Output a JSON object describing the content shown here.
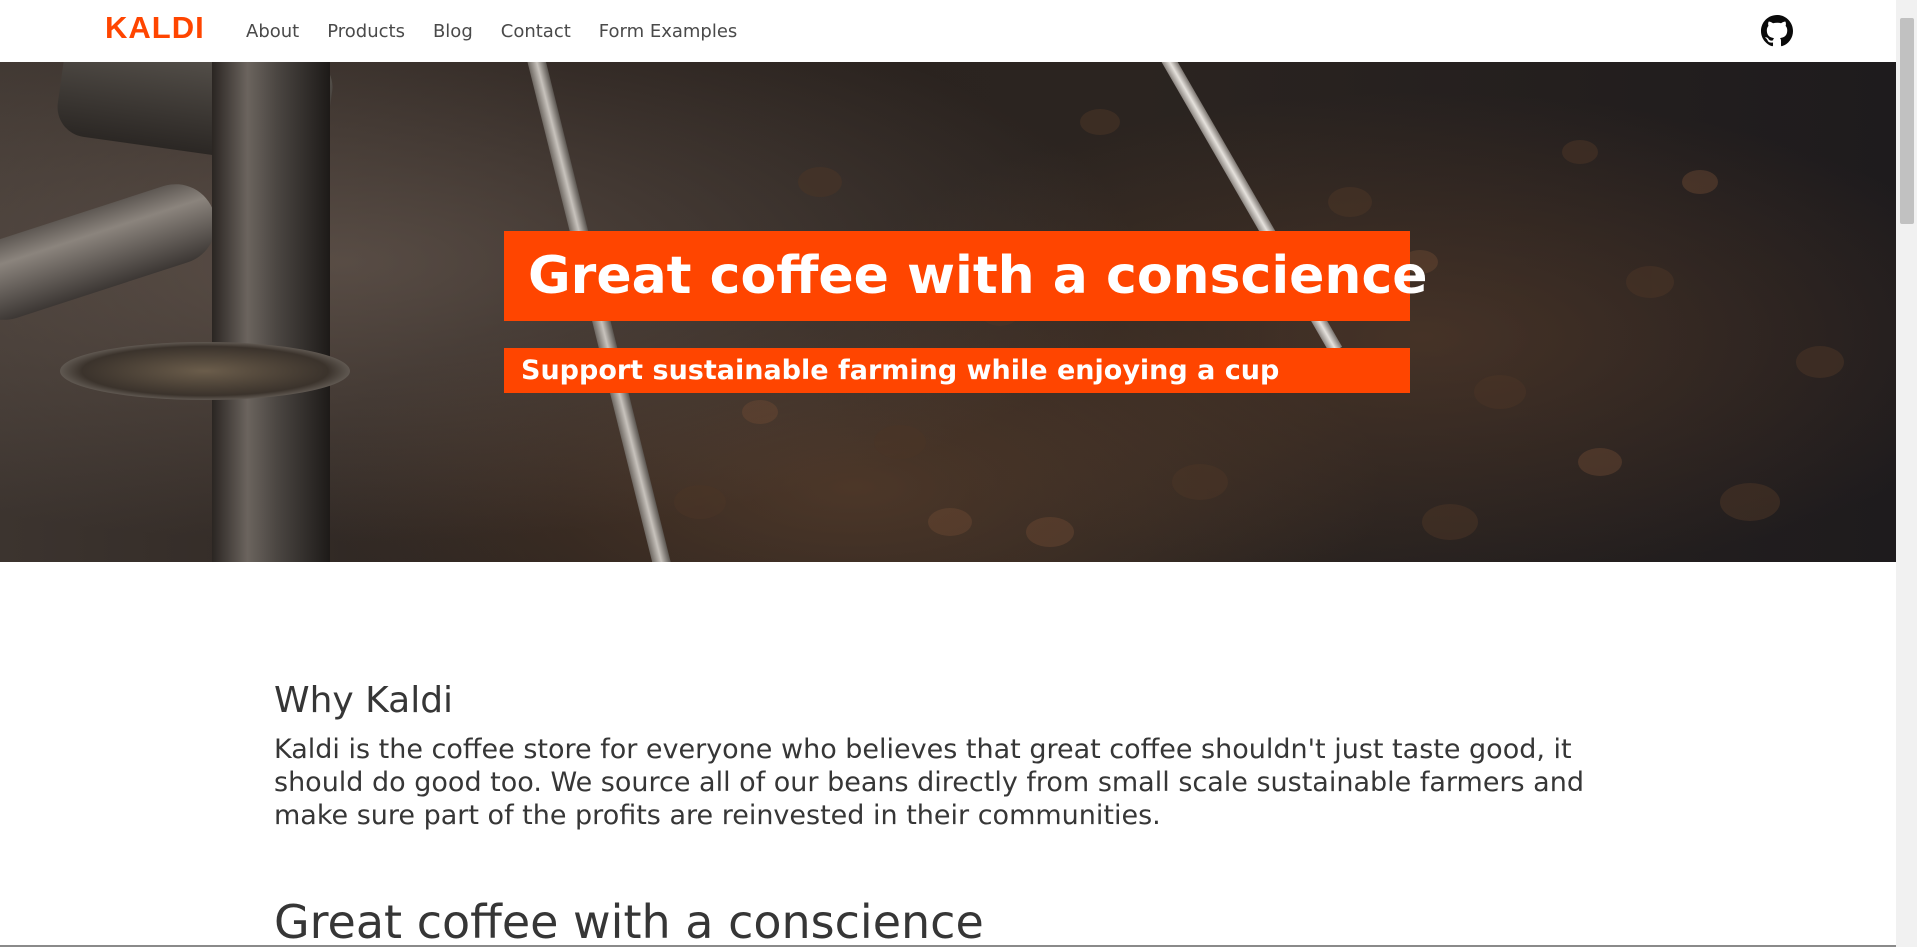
{
  "header": {
    "logo": "KALDI",
    "nav": [
      "About",
      "Products",
      "Blog",
      "Contact",
      "Form Examples"
    ],
    "github_icon": "github-icon"
  },
  "hero": {
    "title": "Great coffee with a conscience",
    "subtitle": "Support sustainable farming while enjoying a cup",
    "accent_color": "#ff4500"
  },
  "main": {
    "why_title": "Why Kaldi",
    "why_text": "Kaldi is the coffee store for everyone who believes that great coffee shouldn't just taste good, it should do good too. We source all of our beans directly from small scale sustainable farmers and make sure part of the profits are reinvested in their communities.",
    "second_title": "Great coffee with a conscience"
  }
}
